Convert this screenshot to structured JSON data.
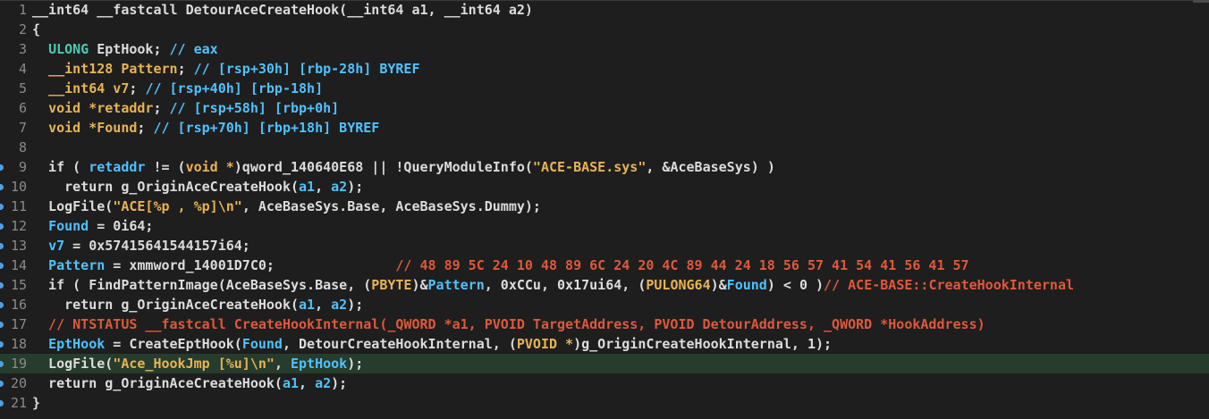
{
  "colors": {
    "background": "#1e1e1e",
    "gutter_text": "#8a8a8a",
    "highlight_line": "#263c2c",
    "breakpoint_marker": "#4f9fe6",
    "plain": "#dcdcdc",
    "type": "#4ec9b0",
    "local": "#4fc1ff",
    "string": "#e8b354",
    "comment": "#e0583a"
  },
  "lines": [
    {
      "n": "1",
      "bp": false,
      "hl": false,
      "tokens": [
        {
          "t": "__int64 __fastcall DetourAceCreateHook(__int64 a1, __int64 a2)",
          "c": "p"
        }
      ]
    },
    {
      "n": "2",
      "bp": false,
      "hl": false,
      "tokens": [
        {
          "t": "{",
          "c": "p"
        }
      ]
    },
    {
      "n": "3",
      "bp": false,
      "hl": false,
      "tokens": [
        {
          "t": "  ",
          "c": "p"
        },
        {
          "t": "ULONG",
          "c": "t"
        },
        {
          "t": " EptHook; ",
          "c": "p"
        },
        {
          "t": "// eax",
          "c": "c"
        }
      ]
    },
    {
      "n": "4",
      "bp": false,
      "hl": false,
      "tokens": [
        {
          "t": "  ",
          "c": "p"
        },
        {
          "t": "__int128 Pattern",
          "c": "cast"
        },
        {
          "t": "; ",
          "c": "p"
        },
        {
          "t": "// [rsp+30h] [rbp-28h] BYREF",
          "c": "c"
        }
      ]
    },
    {
      "n": "5",
      "bp": false,
      "hl": false,
      "tokens": [
        {
          "t": "  ",
          "c": "p"
        },
        {
          "t": "__int64 v7",
          "c": "cast"
        },
        {
          "t": "; ",
          "c": "p"
        },
        {
          "t": "// [rsp+40h] [rbp-18h]",
          "c": "c"
        }
      ]
    },
    {
      "n": "6",
      "bp": false,
      "hl": false,
      "tokens": [
        {
          "t": "  ",
          "c": "p"
        },
        {
          "t": "void *retaddr",
          "c": "cast"
        },
        {
          "t": "; ",
          "c": "p"
        },
        {
          "t": "// [rsp+58h] [rbp+0h]",
          "c": "c"
        }
      ]
    },
    {
      "n": "7",
      "bp": false,
      "hl": false,
      "tokens": [
        {
          "t": "  ",
          "c": "p"
        },
        {
          "t": "void *Found",
          "c": "cast"
        },
        {
          "t": "; ",
          "c": "p"
        },
        {
          "t": "// [rsp+70h] [rbp+18h] BYREF",
          "c": "c"
        }
      ]
    },
    {
      "n": "8",
      "bp": false,
      "hl": false,
      "tokens": []
    },
    {
      "n": "9",
      "bp": true,
      "hl": false,
      "tokens": [
        {
          "t": "  if ( ",
          "c": "p"
        },
        {
          "t": "retaddr",
          "c": "l"
        },
        {
          "t": " != (",
          "c": "p"
        },
        {
          "t": "void *",
          "c": "cast"
        },
        {
          "t": ")qword_140640E68 || !QueryModuleInfo(",
          "c": "p"
        },
        {
          "t": "\"ACE-BASE.sys\"",
          "c": "s"
        },
        {
          "t": ", &AceBaseSys) )",
          "c": "p"
        }
      ]
    },
    {
      "n": "10",
      "bp": true,
      "hl": false,
      "tokens": [
        {
          "t": "    return g_OriginAceCreateHook(",
          "c": "p"
        },
        {
          "t": "a1",
          "c": "l"
        },
        {
          "t": ", ",
          "c": "p"
        },
        {
          "t": "a2",
          "c": "l"
        },
        {
          "t": ");",
          "c": "p"
        }
      ]
    },
    {
      "n": "11",
      "bp": true,
      "hl": false,
      "tokens": [
        {
          "t": "  LogFile(",
          "c": "p"
        },
        {
          "t": "\"ACE[%p , %p]\\n\"",
          "c": "s"
        },
        {
          "t": ", AceBaseSys.Base, AceBaseSys.Dummy);",
          "c": "p"
        }
      ]
    },
    {
      "n": "12",
      "bp": true,
      "hl": false,
      "tokens": [
        {
          "t": "  ",
          "c": "p"
        },
        {
          "t": "Found",
          "c": "l"
        },
        {
          "t": " = 0i64;",
          "c": "p"
        }
      ]
    },
    {
      "n": "13",
      "bp": true,
      "hl": false,
      "tokens": [
        {
          "t": "  ",
          "c": "p"
        },
        {
          "t": "v7",
          "c": "l"
        },
        {
          "t": " = 0x57415641544157i64;",
          "c": "p"
        }
      ]
    },
    {
      "n": "14",
      "bp": true,
      "hl": false,
      "tokens": [
        {
          "t": "  ",
          "c": "p"
        },
        {
          "t": "Pattern",
          "c": "l"
        },
        {
          "t": " = xmmword_14001D7C0;               ",
          "c": "p"
        },
        {
          "t": "// 48 89 5C 24 10 48 89 6C 24 20 4C 89 44 24 18 56 57 41 54 41 56 41 57",
          "c": "cm"
        }
      ]
    },
    {
      "n": "15",
      "bp": true,
      "hl": false,
      "tokens": [
        {
          "t": "  if ( FindPatternImage(AceBaseSys.Base, (",
          "c": "p"
        },
        {
          "t": "PBYTE",
          "c": "cast"
        },
        {
          "t": ")&",
          "c": "p"
        },
        {
          "t": "Pattern",
          "c": "l"
        },
        {
          "t": ", 0xCCu, 0x17ui64, (",
          "c": "p"
        },
        {
          "t": "PULONG64",
          "c": "cast"
        },
        {
          "t": ")&",
          "c": "p"
        },
        {
          "t": "Found",
          "c": "l"
        },
        {
          "t": ") < 0 )",
          "c": "p"
        },
        {
          "t": "// ACE-BASE::CreateHookInternal",
          "c": "cm"
        }
      ]
    },
    {
      "n": "16",
      "bp": true,
      "hl": false,
      "tokens": [
        {
          "t": "    return g_OriginAceCreateHook(",
          "c": "p"
        },
        {
          "t": "a1",
          "c": "l"
        },
        {
          "t": ", ",
          "c": "p"
        },
        {
          "t": "a2",
          "c": "l"
        },
        {
          "t": ");",
          "c": "p"
        }
      ]
    },
    {
      "n": "17",
      "bp": true,
      "hl": false,
      "tokens": [
        {
          "t": "  // NTSTATUS __fastcall CreateHookInternal(_QWORD *a1, PVOID TargetAddress, PVOID DetourAddress, _QWORD *HookAddress)",
          "c": "cm"
        }
      ]
    },
    {
      "n": "18",
      "bp": true,
      "hl": false,
      "tokens": [
        {
          "t": "  ",
          "c": "p"
        },
        {
          "t": "EptHook",
          "c": "l"
        },
        {
          "t": " = CreateEptHook(",
          "c": "p"
        },
        {
          "t": "Found",
          "c": "l"
        },
        {
          "t": ", DetourCreateHookInternal, (",
          "c": "p"
        },
        {
          "t": "PVOID *",
          "c": "cast"
        },
        {
          "t": ")g_OriginCreateHookInternal, 1);",
          "c": "p"
        }
      ]
    },
    {
      "n": "19",
      "bp": true,
      "hl": true,
      "tokens": [
        {
          "t": "  LogFile(",
          "c": "p"
        },
        {
          "t": "\"Ace_HookJmp [%u]\\n\"",
          "c": "s"
        },
        {
          "t": ", ",
          "c": "p"
        },
        {
          "t": "EptHook",
          "c": "l"
        },
        {
          "t": ");",
          "c": "p"
        }
      ]
    },
    {
      "n": "20",
      "bp": true,
      "hl": false,
      "tokens": [
        {
          "t": "  return g_OriginAceCreateHook(",
          "c": "p"
        },
        {
          "t": "a1",
          "c": "l"
        },
        {
          "t": ", ",
          "c": "p"
        },
        {
          "t": "a2",
          "c": "l"
        },
        {
          "t": ");",
          "c": "p"
        }
      ]
    },
    {
      "n": "21",
      "bp": true,
      "hl": false,
      "tokens": [
        {
          "t": "}",
          "c": "p"
        }
      ]
    }
  ]
}
